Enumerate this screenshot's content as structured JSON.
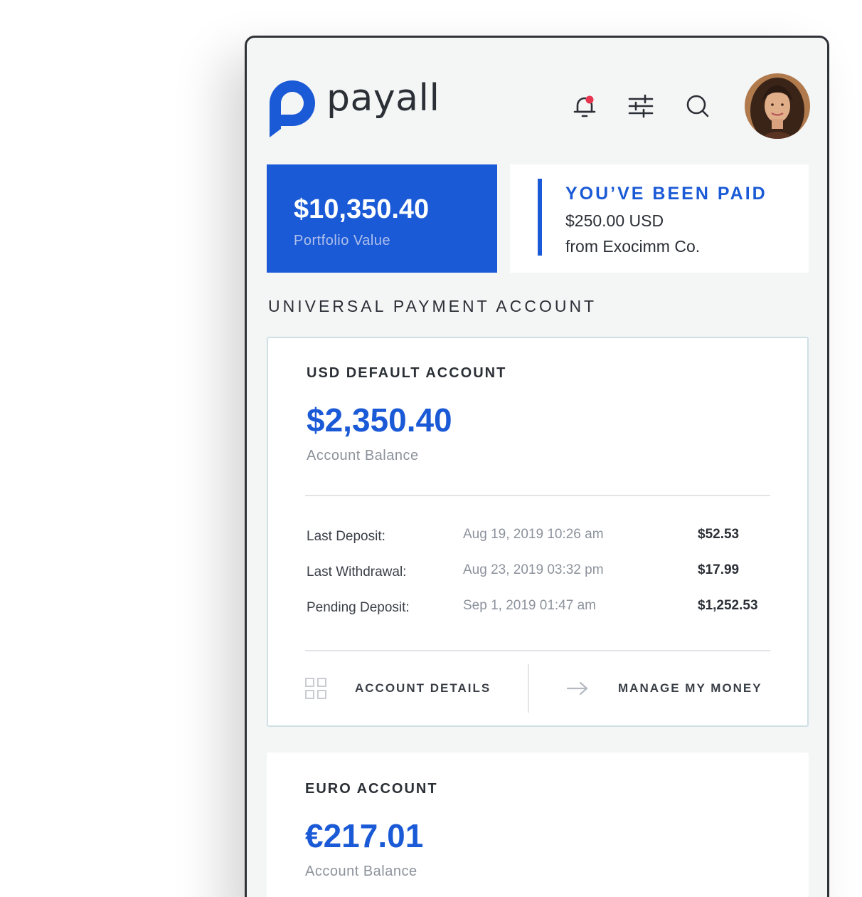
{
  "brand": {
    "name": "payall",
    "color": "#1b5ad6"
  },
  "header": {
    "icons": [
      "notification-bell-icon",
      "filter-sliders-icon",
      "search-icon"
    ],
    "notification_dot_color": "#e8344e"
  },
  "portfolio": {
    "value": "$10,350.40",
    "label": "Portfolio Value"
  },
  "paid_notice": {
    "title": "YOU’VE BEEN PAID",
    "amount": "$250.00 USD",
    "from": "from Exocimm Co."
  },
  "section_title": "UNIVERSAL PAYMENT ACCOUNT",
  "accounts": [
    {
      "name": "USD DEFAULT ACCOUNT",
      "balance": "$2,350.40",
      "balance_label": "Account Balance",
      "transactions": [
        {
          "label": "Last Deposit:",
          "date": "Aug 19, 2019  10:26 am",
          "amount": "$52.53"
        },
        {
          "label": "Last Withdrawal:",
          "date": "Aug 23, 2019  03:32 pm",
          "amount": "$17.99"
        },
        {
          "label": "Pending Deposit:",
          "date": "Sep 1, 2019  01:47 am",
          "amount": "$1,252.53"
        }
      ],
      "actions": {
        "details": "ACCOUNT DETAILS",
        "manage": "MANAGE MY MONEY"
      }
    },
    {
      "name": "EURO ACCOUNT",
      "balance": "€217.01",
      "balance_label": "Account Balance"
    }
  ]
}
